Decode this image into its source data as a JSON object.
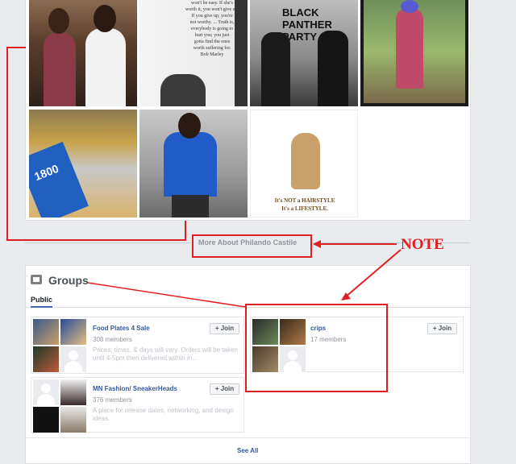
{
  "photos": {
    "poster_quote": "won't be easy. If she's\nworth it, you won't give up.\nIf you give up, you're\nnot worthy. ... Truth is,\neverybody is going to\nhurt you; you just\ngotta find the ones\nworth suffering for.\nBob Marley",
    "panther_sign": "BLACK PANTHER\nPARTY",
    "bottle_label": "1800",
    "hairstyle_caption_1": "It's NOT a HAIRSTYLE",
    "hairstyle_caption_2": "It's a LIFESTYLE."
  },
  "profile": {
    "more_about": "More About Philando Castile"
  },
  "groups": {
    "title": "Groups",
    "tab": "Public",
    "join_label": "Join",
    "join_icon": "plus-icon",
    "see_all": "See All",
    "items": [
      {
        "name": "Food Plates 4 Sale",
        "members": "308 members",
        "description": "Prices, times, & days will vary. Orders will be taken until 4-5pm then delivered within in..."
      },
      {
        "name": "crips",
        "members": "17 members",
        "description": ""
      },
      {
        "name": "MN Fashion/ SneakerHeads",
        "members": "376 members",
        "description": "A place for release dates, networking, and design ideas."
      }
    ]
  },
  "annotation": {
    "note": "NOTE",
    "color": "#e02020"
  }
}
